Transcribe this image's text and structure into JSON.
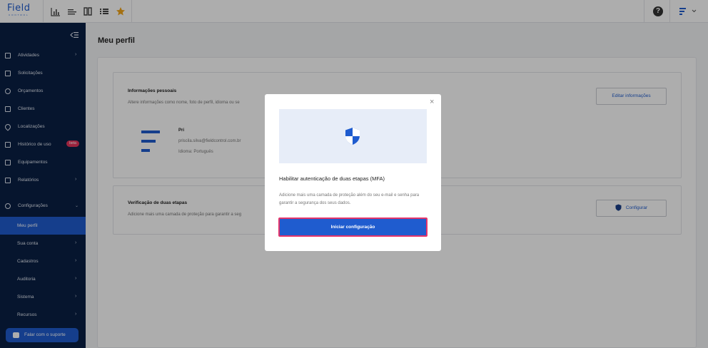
{
  "app": {
    "logo_text": "Field",
    "logo_sub": "CONTROL"
  },
  "toolbar": {
    "icons": [
      "bar-chart-icon",
      "list-lines-icon",
      "book-icon",
      "list-icon",
      "star-icon"
    ],
    "star_color": "#f2a51a"
  },
  "sidebar": {
    "items": [
      {
        "label": "Atividades",
        "icon": "clipboard-icon",
        "chevron": true
      },
      {
        "label": "Solicitações",
        "icon": "inbox-icon"
      },
      {
        "label": "Orçamentos",
        "icon": "dollar-icon"
      },
      {
        "label": "Clientes",
        "icon": "contacts-icon"
      },
      {
        "label": "Localizações",
        "icon": "location-pin-icon"
      },
      {
        "label": "Histórico de uso",
        "icon": "car-icon",
        "badge": "beta"
      },
      {
        "label": "Equipamentos",
        "icon": "equipment-icon"
      },
      {
        "label": "Relatórios",
        "icon": "report-icon",
        "chevron": true
      },
      {
        "label": "Configurações",
        "icon": "gear-icon",
        "chevron_down": true
      }
    ],
    "sub_items": [
      {
        "label": "Meu perfil",
        "active": true
      },
      {
        "label": "Sua conta"
      },
      {
        "label": "Cadastros"
      },
      {
        "label": "Auditoria"
      },
      {
        "label": "Sistema"
      },
      {
        "label": "Recursos"
      }
    ],
    "support_label": "Falar com o suporte",
    "bg_color": "#0a1f44",
    "active_color": "#1f5ccf"
  },
  "main": {
    "title": "Meu perfil",
    "personal": {
      "title": "Informações pessoais",
      "desc": "Altere informações como nome, foto de perfil, idioma ou se",
      "button": "Editar informações",
      "name": "Pri",
      "email": "priscila.silva@fieldcontrol.com.br",
      "language": "Idioma: Português"
    },
    "twofa": {
      "title": "Verificação de duas etapas",
      "desc": "Adicione mais uma camada de proteção para garantir a seg",
      "button": "Configurar"
    }
  },
  "modal": {
    "title": "Habilitar autenticação de duas etapas (MFA)",
    "desc": "Adicione mais uma camada de proteção além do seu e-mail e senha para garantir a segurança dos seus dados.",
    "button": "Iniciar configuração",
    "close": "×"
  }
}
